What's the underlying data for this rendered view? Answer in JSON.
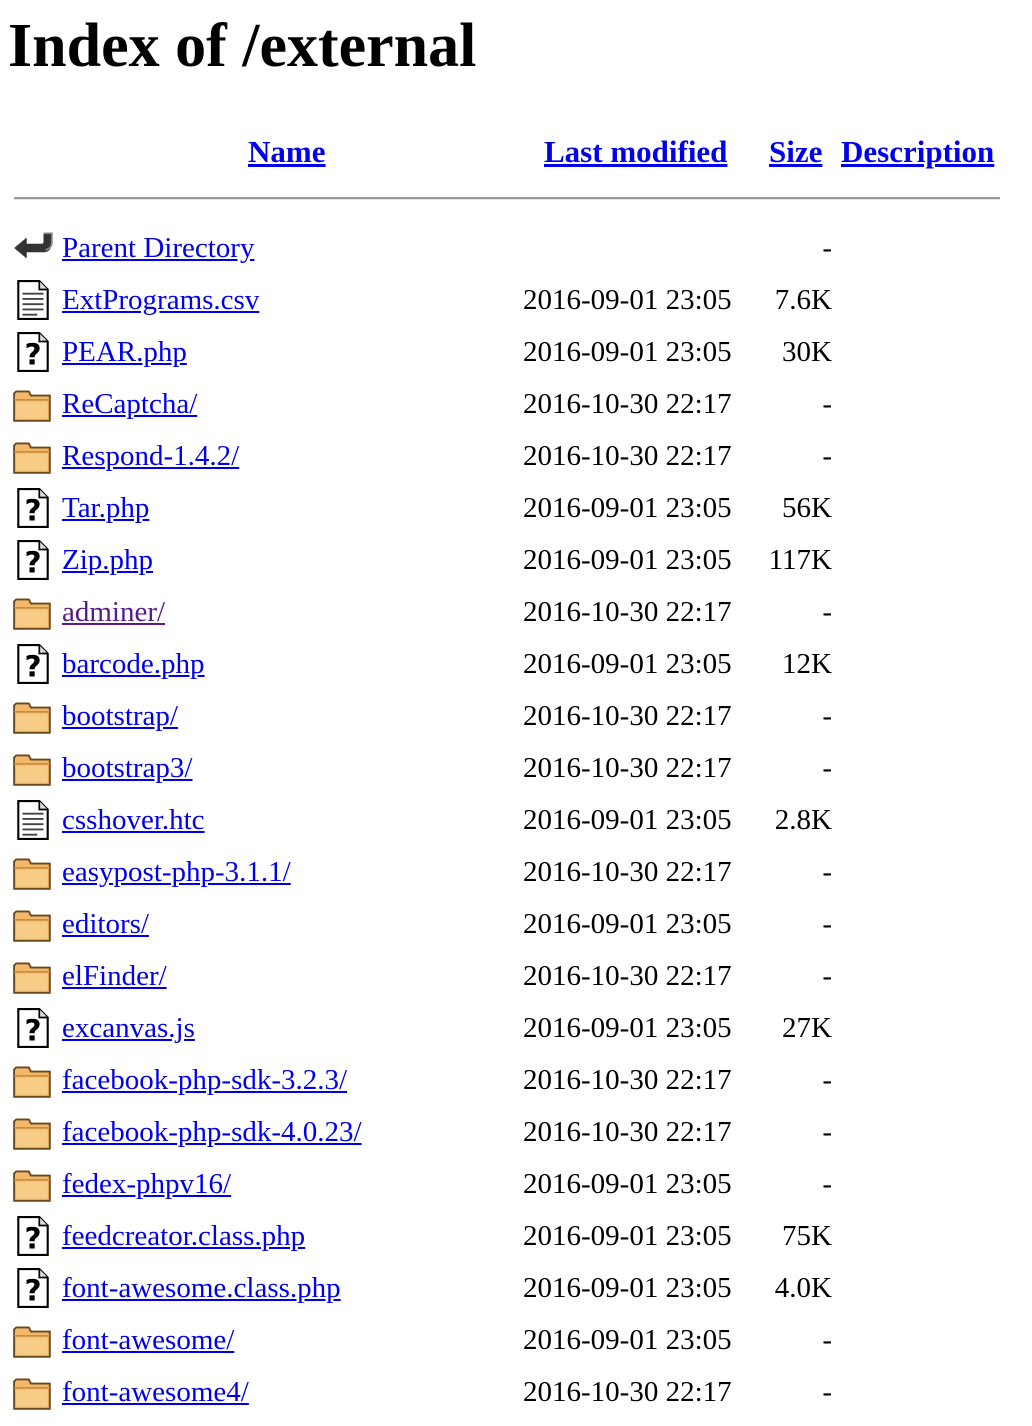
{
  "page": {
    "title": "Index of /external"
  },
  "columns": {
    "name": "Name",
    "last_modified": "Last modified",
    "size": "Size",
    "description": "Description"
  },
  "entries": [
    {
      "icon": "back-icon",
      "name": "Parent Directory",
      "modified": "",
      "size": "-",
      "visited": false
    },
    {
      "icon": "text-file-icon",
      "name": "ExtPrograms.csv",
      "modified": "2016-09-01 23:05",
      "size": "7.6K",
      "visited": false
    },
    {
      "icon": "unknown-file-icon",
      "name": "PEAR.php",
      "modified": "2016-09-01 23:05",
      "size": "30K",
      "visited": false
    },
    {
      "icon": "folder-icon",
      "name": "ReCaptcha/",
      "modified": "2016-10-30 22:17",
      "size": "-",
      "visited": false
    },
    {
      "icon": "folder-icon",
      "name": "Respond-1.4.2/",
      "modified": "2016-10-30 22:17",
      "size": "-",
      "visited": false
    },
    {
      "icon": "unknown-file-icon",
      "name": "Tar.php",
      "modified": "2016-09-01 23:05",
      "size": "56K",
      "visited": false
    },
    {
      "icon": "unknown-file-icon",
      "name": "Zip.php",
      "modified": "2016-09-01 23:05",
      "size": "117K",
      "visited": false
    },
    {
      "icon": "folder-icon",
      "name": "adminer/",
      "modified": "2016-10-30 22:17",
      "size": "-",
      "visited": true
    },
    {
      "icon": "unknown-file-icon",
      "name": "barcode.php",
      "modified": "2016-09-01 23:05",
      "size": "12K",
      "visited": false
    },
    {
      "icon": "folder-icon",
      "name": "bootstrap/",
      "modified": "2016-10-30 22:17",
      "size": "-",
      "visited": false
    },
    {
      "icon": "folder-icon",
      "name": "bootstrap3/",
      "modified": "2016-10-30 22:17",
      "size": "-",
      "visited": false
    },
    {
      "icon": "text-file-icon",
      "name": "csshover.htc",
      "modified": "2016-09-01 23:05",
      "size": "2.8K",
      "visited": false
    },
    {
      "icon": "folder-icon",
      "name": "easypost-php-3.1.1/",
      "modified": "2016-10-30 22:17",
      "size": "-",
      "visited": false
    },
    {
      "icon": "folder-icon",
      "name": "editors/",
      "modified": "2016-09-01 23:05",
      "size": "-",
      "visited": false
    },
    {
      "icon": "folder-icon",
      "name": "elFinder/",
      "modified": "2016-10-30 22:17",
      "size": "-",
      "visited": false
    },
    {
      "icon": "unknown-file-icon",
      "name": "excanvas.js",
      "modified": "2016-09-01 23:05",
      "size": "27K",
      "visited": false
    },
    {
      "icon": "folder-icon",
      "name": "facebook-php-sdk-3.2.3/",
      "modified": "2016-10-30 22:17",
      "size": "-",
      "visited": false
    },
    {
      "icon": "folder-icon",
      "name": "facebook-php-sdk-4.0.23/",
      "modified": "2016-10-30 22:17",
      "size": "-",
      "visited": false
    },
    {
      "icon": "folder-icon",
      "name": "fedex-phpv16/",
      "modified": "2016-09-01 23:05",
      "size": "-",
      "visited": false
    },
    {
      "icon": "unknown-file-icon",
      "name": "feedcreator.class.php",
      "modified": "2016-09-01 23:05",
      "size": "75K",
      "visited": false
    },
    {
      "icon": "unknown-file-icon",
      "name": "font-awesome.class.php",
      "modified": "2016-09-01 23:05",
      "size": "4.0K",
      "visited": false
    },
    {
      "icon": "folder-icon",
      "name": "font-awesome/",
      "modified": "2016-09-01 23:05",
      "size": "-",
      "visited": false
    },
    {
      "icon": "folder-icon",
      "name": "font-awesome4/",
      "modified": "2016-10-30 22:17",
      "size": "-",
      "visited": false
    }
  ]
}
